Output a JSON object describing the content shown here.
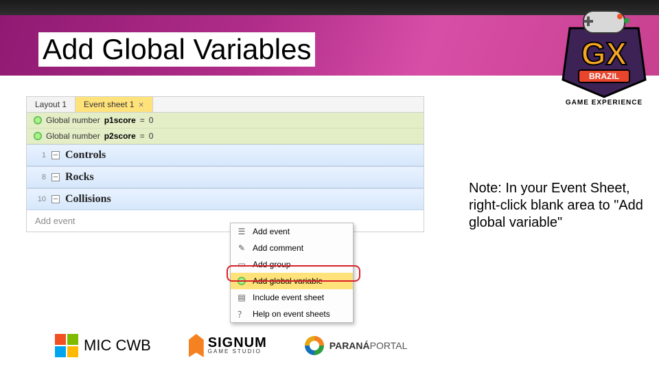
{
  "title": "Add Global Variables",
  "gx": {
    "brand": "BRAZIL",
    "caption": "GAME EXPERIENCE"
  },
  "editor": {
    "tabs": {
      "layout": "Layout 1",
      "sheet": "Event sheet 1"
    },
    "globals": {
      "g1_pre": "Global number ",
      "g1_name": "p1score",
      "g1_eq": " = ",
      "g1_val": "0",
      "g2_pre": "Global number ",
      "g2_name": "p2score",
      "g2_eq": " = ",
      "g2_val": "0"
    },
    "groups": {
      "g1_num": "1",
      "g1_label": "Controls",
      "g2_num": "8",
      "g2_label": "Rocks",
      "g3_num": "10",
      "g3_label": "Collisions"
    },
    "add_event": "Add event"
  },
  "menu": {
    "add_event": "Add event",
    "add_comment": "Add comment",
    "add_group": "Add group",
    "add_global": "Add global variable",
    "include": "Include event sheet",
    "help": "Help on event sheets"
  },
  "note": "Note: In your Event Sheet, right-click blank area to \"Add global variable\"",
  "footer": {
    "mic_a": "MIC",
    "mic_b": " CWB",
    "signum_a": "SIGNUM",
    "signum_b": "GAME STUDIO",
    "parana_a": "PARANÁ",
    "parana_b": "PORTAL"
  },
  "icons": {
    "dash": "─"
  }
}
